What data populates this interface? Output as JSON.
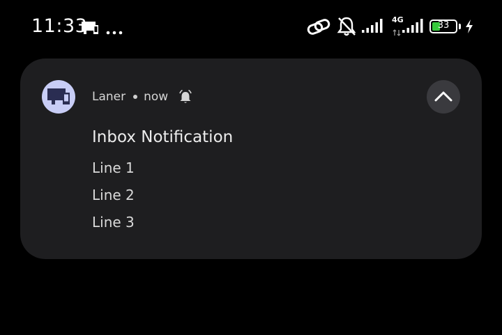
{
  "status_bar": {
    "time": "11:33",
    "network_type": "4G",
    "battery_level": "33",
    "battery_percent": 33,
    "battery_color": "#36c93b",
    "icons": [
      "cast-icon",
      "more-dots-icon",
      "link-icon",
      "bell-off-icon",
      "signal-icon",
      "signal-icon",
      "battery-icon",
      "charging-icon"
    ]
  },
  "notification": {
    "app_name": "Laner",
    "timestamp": "now",
    "app_icon": "monitor-icon",
    "app_icon_color": "#c8cdf6",
    "alert_icon": "alarm-bell-icon",
    "title": "Inbox Notification",
    "lines": [
      "Line 1",
      "Line 2",
      "Line 3"
    ],
    "expand_icon": "chevron-up-icon"
  }
}
